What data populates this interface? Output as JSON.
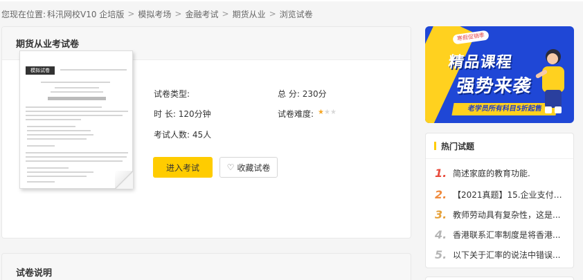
{
  "breadcrumb": {
    "prefix": "您现在位置:",
    "items": [
      "科汛网校V10 企培版",
      "模拟考场",
      "金融考试",
      "期货从业",
      "浏览试卷"
    ],
    "separator": ">"
  },
  "exam": {
    "title": "期货从业考试卷",
    "type_label": "试卷类型:",
    "type_value": "",
    "score_label": "总 分:",
    "score_value": "230分",
    "duration_label": "时 长:",
    "duration_value": "120分钟",
    "difficulty_label": "试卷难度:",
    "difficulty_stars": 1,
    "difficulty_max": 3,
    "takers_label": "考试人数:",
    "takers_value": "45人",
    "enter_button": "进入考试",
    "favorite_button": "收藏试卷",
    "thumbnail_tag": "模拟试卷"
  },
  "description": {
    "title": "试卷说明"
  },
  "banner": {
    "pill": "寒假促销季",
    "line1": "精品课程",
    "line2": "强势来袭",
    "subtitle": "老学员所有科目5折起售"
  },
  "hot": {
    "title": "热门试题",
    "items": [
      {
        "num": "1.",
        "text": "简述家庭的教育功能.",
        "color": "#e84c3d"
      },
      {
        "num": "2.",
        "text": "【2021真题】15.企业支付的...",
        "color": "#f08a3c"
      },
      {
        "num": "3.",
        "text": "教师劳动具有复杂性，这是...",
        "color": "#e6a23c"
      },
      {
        "num": "4.",
        "text": "香港联系汇率制度是将香港...",
        "color": "#b5b5b5"
      },
      {
        "num": "5.",
        "text": "以下关于汇率的说法中错误...",
        "color": "#b5b5b5"
      }
    ]
  },
  "colors": {
    "accent": "#ffcc00",
    "banner_blue": "#1f47d6"
  }
}
